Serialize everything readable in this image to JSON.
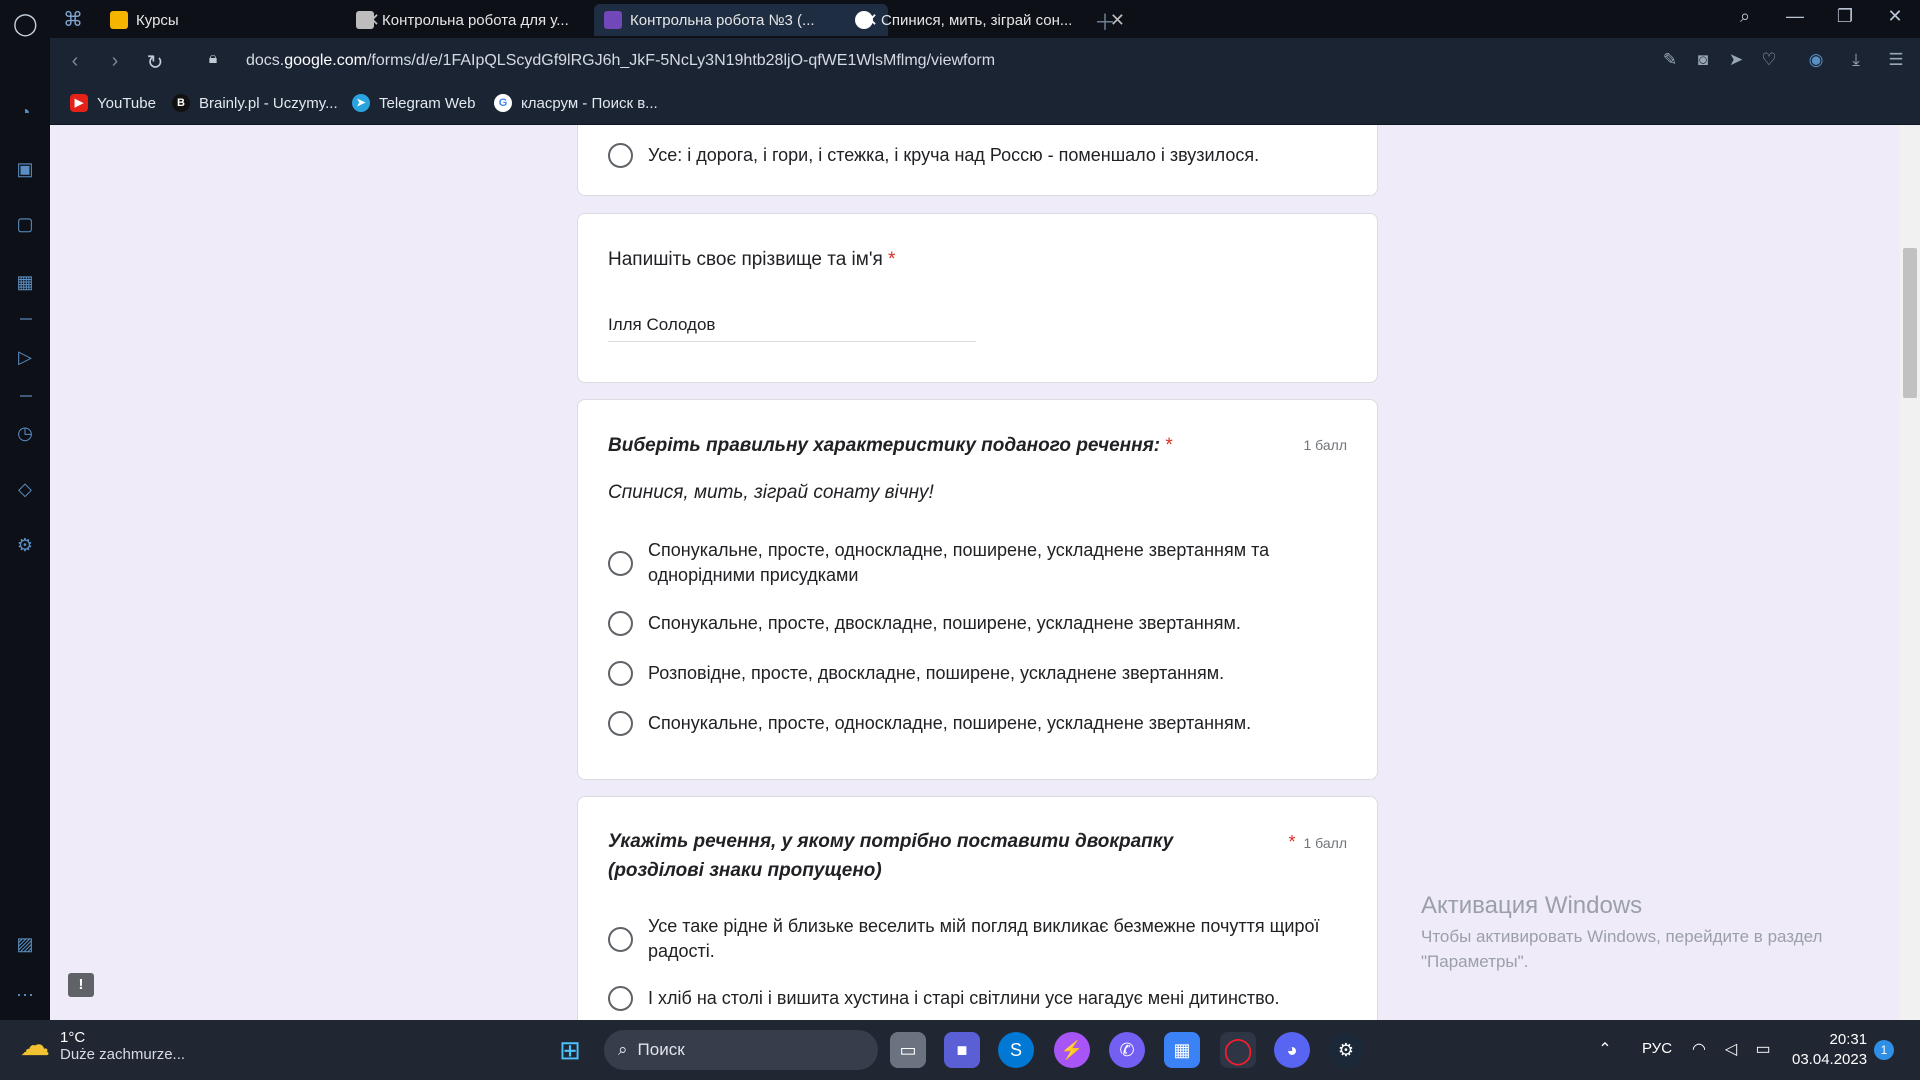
{
  "browser": {
    "tabs": [
      {
        "label": "Курсы"
      },
      {
        "label": "Контрольна робота для у..."
      },
      {
        "label": "Контрольна робота №3 (..."
      },
      {
        "label": "Спинися, мить, зіграй сон..."
      }
    ],
    "url_prefix": "docs.",
    "url_host": "google.com",
    "url_path": "/forms/d/e/1FAIpQLScydGf9lRGJ6h_JkF-5NcLy3N19htb28ljO-qfWE1WlsMflmg/viewform",
    "bookmarks": [
      {
        "label": "YouTube",
        "icon": "youtube-icon"
      },
      {
        "label": "Brainly.pl - Uczymy...",
        "icon": "brainly-icon"
      },
      {
        "label": "Telegram Web",
        "icon": "telegram-icon"
      },
      {
        "label": "класрум - Поиск в...",
        "icon": "google-icon"
      }
    ]
  },
  "form": {
    "prev_option": "Усе: і дорога, і гори, і стежка, і круча над Россю - поменшало і звузилося.",
    "name_question": {
      "title": "Напишіть своє прізвище та ім'я",
      "required_mark": "*",
      "value": "Ілля Солодов"
    },
    "q1": {
      "title": "Виберіть правильну характеристику поданого речення:",
      "required_mark": "*",
      "points": "1 балл",
      "sentence": "Спинися, мить, зіграй сонату вічну!",
      "options": [
        "Спонукальне, просте, односкладне, поширене, ускладнене звертанням та однорідними присудками",
        "Спонукальне, просте, двоскладне, поширене, ускладнене звертанням.",
        "Розповідне, просте, двоскладне, поширене, ускладнене звертанням.",
        "Спонукальне, просте, односкладне, поширене, ускладнене звертанням."
      ]
    },
    "q2": {
      "title": "Укажіть речення, у якому потрібно поставити двокрапку (розділові знаки пропущено)",
      "required_mark": "*",
      "points": "1 балл",
      "options": [
        "Усе таке рідне й близьке веселить мій погляд викликає безмежне почуття щирої радості.",
        "І хліб на столі і вишита хустина і старі світлини усе нагадує мені дитинство."
      ]
    }
  },
  "watermark": {
    "title": "Активация Windows",
    "subtitle": "Чтобы активировать Windows, перейдите в раздел \"Параметры\"."
  },
  "taskbar": {
    "weather_temp": "1°C",
    "weather_desc": "Duże zachmurze...",
    "search_label": "Поиск",
    "lang": "РУС",
    "time": "20:31",
    "date": "03.04.2023",
    "notifications": "1"
  },
  "colors": {
    "page_bg": "#f0ebf8",
    "required": "#d93025",
    "browser_dark": "#0d1117",
    "toolbar": "#1b2433"
  }
}
